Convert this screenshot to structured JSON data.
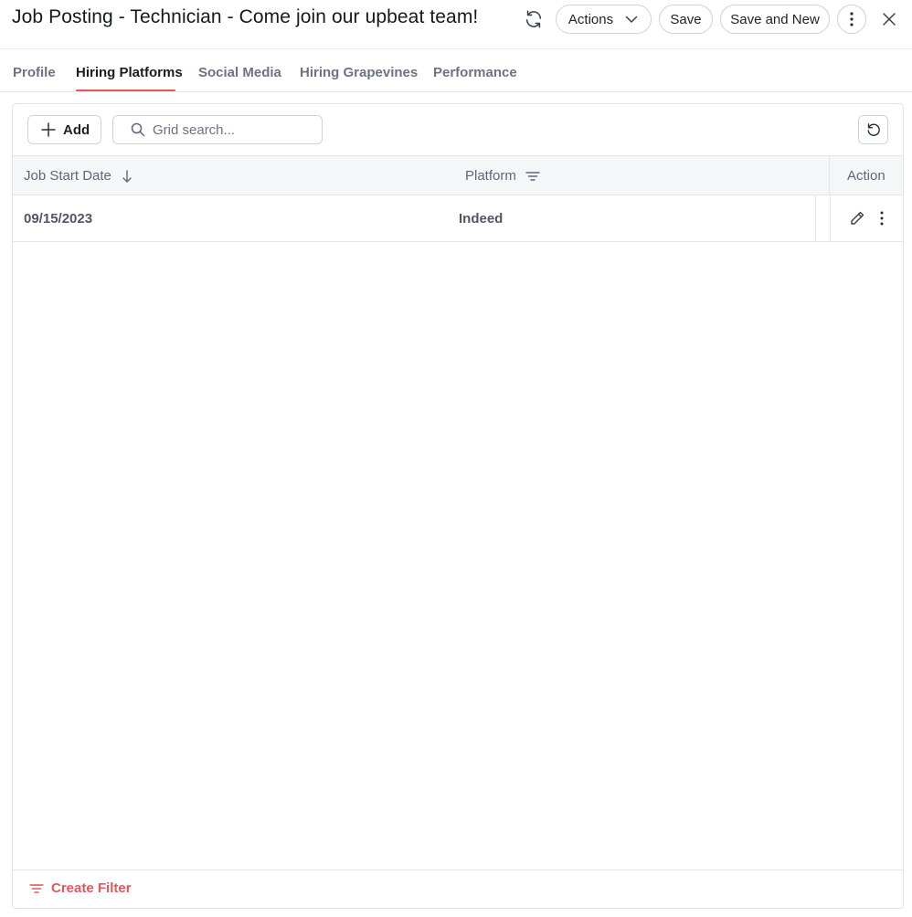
{
  "header": {
    "title": "Job Posting - Technician - Come join our upbeat team!",
    "refresh_icon": "refresh-icon",
    "actions_label": "Actions",
    "save_label": "Save",
    "save_new_label": "Save and New",
    "more_icon": "vertical-dots-icon",
    "close_icon": "close-icon"
  },
  "tabs": [
    {
      "label": "Profile",
      "active": false
    },
    {
      "label": "Hiring Platforms",
      "active": true
    },
    {
      "label": "Social Media",
      "active": false
    },
    {
      "label": "Hiring Grapevines",
      "active": false
    },
    {
      "label": "Performance",
      "active": false
    }
  ],
  "toolbar": {
    "add_label": "Add",
    "search_placeholder": "Grid search...",
    "search_value": ""
  },
  "grid": {
    "columns": [
      "Job Start Date",
      "Platform",
      "Action"
    ],
    "sort_column": "Job Start Date",
    "sort_direction": "desc",
    "rows": [
      {
        "job_start_date": "09/15/2023",
        "platform": "Indeed"
      }
    ]
  },
  "footer": {
    "create_filter_label": "Create Filter"
  },
  "colors": {
    "accent": "#e0585c",
    "border": "#cfd3da",
    "header_bg": "#f5f6f8",
    "muted_text": "#6b7385"
  }
}
